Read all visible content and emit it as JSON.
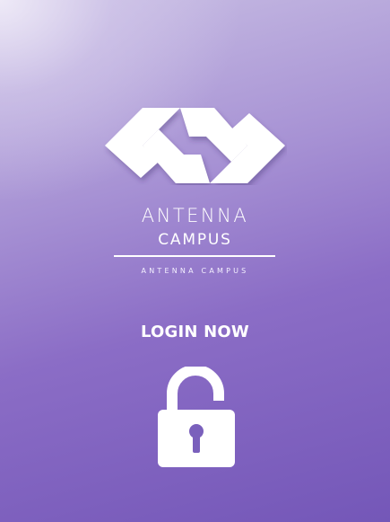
{
  "brand": {
    "title": "ANTENNA",
    "subtitle": "CAMPUS",
    "tagline": "ANTENNA CAMPUS"
  },
  "login": {
    "label": "LOGIN NOW"
  },
  "icons": {
    "logo": "antenna-logo-icon",
    "unlock": "unlock-icon"
  },
  "colors": {
    "background_top": "#d8d0ec",
    "background_bottom": "#7457b8",
    "foreground": "#ffffff"
  }
}
